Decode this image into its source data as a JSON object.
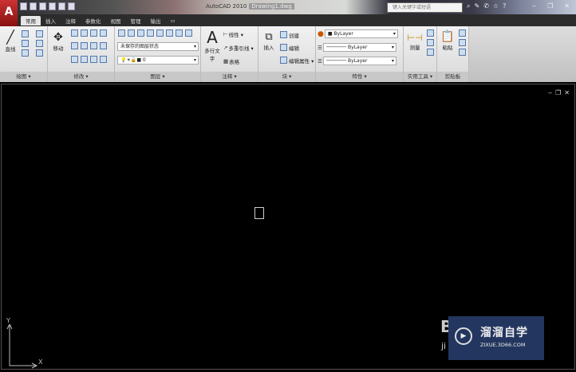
{
  "app": {
    "logo": "A",
    "title": "AutoCAD 2010",
    "document": "Drawing1.dwg",
    "search_placeholder": "键入关键字或短语"
  },
  "tabs": [
    "常用",
    "插入",
    "注释",
    "参数化",
    "视图",
    "管理",
    "输出"
  ],
  "panels": {
    "draw": {
      "label": "绘图 ▾",
      "line": "直线"
    },
    "modify": {
      "label": "修改 ▾",
      "move": "移动"
    },
    "layers": {
      "label": "图层 ▾",
      "layer_state": "未保存的图层状态",
      "current_layer": "0"
    },
    "annotation": {
      "label": "注释 ▾",
      "mtext": "多行文字",
      "linear": "线性 ▾",
      "mleader": "多重引线 ▾",
      "table": "表格"
    },
    "block": {
      "label": "块 ▾",
      "insert": "插入",
      "create": "创建",
      "edit": "编辑",
      "edit_attr": "编辑属性 ▾"
    },
    "properties": {
      "label": "特性 ▾",
      "color": "ByLayer",
      "linetype": "ByLayer",
      "lineweight": "ByLayer"
    },
    "utilities": {
      "label": "实用工具 ▾",
      "measure": "测量"
    },
    "clipboard": {
      "label": "剪贴板",
      "paste": "粘贴"
    }
  },
  "canvas": {
    "controls": [
      "‒",
      "❐",
      "✕"
    ],
    "ucs_y": "Y",
    "ucs_x": "X"
  },
  "watermark": {
    "title": "溜溜自学",
    "site": "ZIXUE.3D66.COM",
    "behind": "B",
    "behind2": "ji"
  }
}
